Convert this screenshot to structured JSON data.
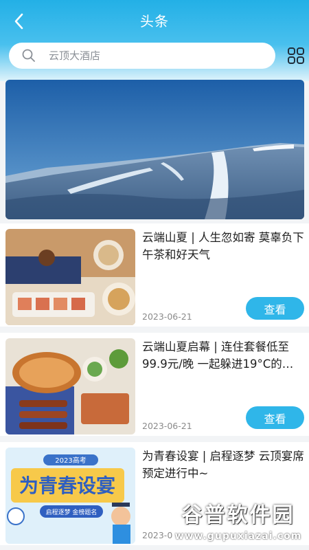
{
  "header": {
    "title": "头条",
    "back_icon": "chevron-left-icon",
    "grid_icon": "grid-icon"
  },
  "search": {
    "placeholder": "云顶大酒店",
    "icon": "search-icon"
  },
  "banner": {
    "image": "snowy-mountain-ski-slope"
  },
  "articles": [
    {
      "title": "云端山夏 | 人生忽如寄 莫辜负下午茶和好天气",
      "date": "2023-06-21",
      "button": "查看",
      "image": "afternoon-tea-food"
    },
    {
      "title": "云端山夏启幕 | 连住套餐低至99.9元/晚 一起躲进19°C的…",
      "date": "2023-06-21",
      "button": "查看",
      "image": "bbq-feast"
    },
    {
      "title": "为青春设宴 | 启程逐梦 云顶宴席预定进行中~",
      "date": "2023-0",
      "image": "graduation-banquet-poster",
      "poster": {
        "top": "2023高考",
        "main": "为青春设宴",
        "sub": "启程逐梦 金榜题名"
      }
    }
  ],
  "watermark": {
    "main": "谷普软件园",
    "sub": "www.gupuxiazai.com"
  },
  "colors": {
    "accent": "#2fb6e9",
    "header": "#23b0e6"
  }
}
